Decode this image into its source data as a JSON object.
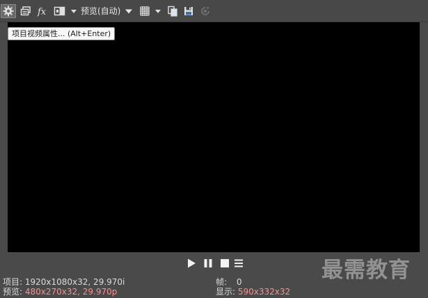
{
  "toolbar": {
    "preview_quality": "预览(自动)",
    "tooltip": "项目视频属性... (Alt+Enter)",
    "icons": [
      "gear-icon",
      "copy-window-icon",
      "fx-icon",
      "split-screen-icon",
      "chevron-down-icon",
      "chevron-down-icon",
      "grid-icon",
      "chevron-down-icon",
      "copy-frame-icon",
      "save-icon",
      "sync-icon"
    ]
  },
  "transport": {
    "icons": [
      "play-icon",
      "pause-icon",
      "stop-icon",
      "menu-icon"
    ]
  },
  "status": {
    "project_label": "项目:",
    "project_value": "1920x1080x32, 29.970i",
    "preview_label": "预览:",
    "preview_value": "480x270x32, 29.970p",
    "frame_label": "帧:",
    "frame_value": "0",
    "display_label": "显示:",
    "display_value": "590x332x32"
  },
  "watermark": "最需教育",
  "colors": {
    "background": "#4a4a4a",
    "viewport": "#000000",
    "highlight_value": "#ff8f8f"
  }
}
